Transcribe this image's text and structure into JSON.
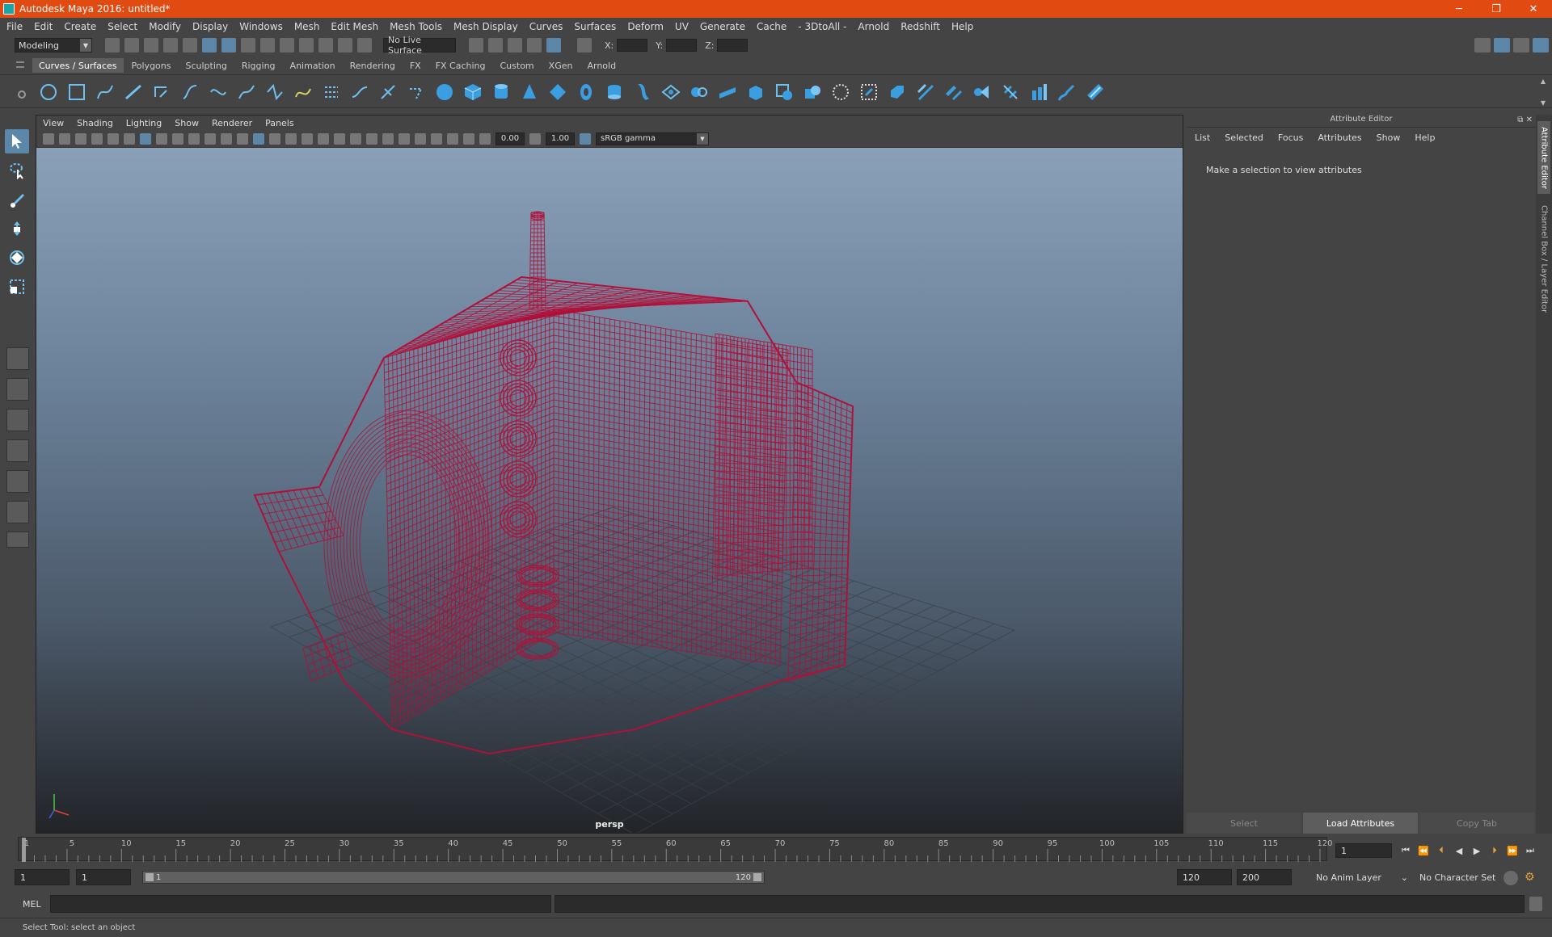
{
  "window": {
    "title": "Autodesk Maya 2016: untitled*",
    "controls": [
      "─",
      "❐",
      "✕"
    ]
  },
  "menubar": [
    "File",
    "Edit",
    "Create",
    "Select",
    "Modify",
    "Display",
    "Windows",
    "Mesh",
    "Edit Mesh",
    "Mesh Tools",
    "Mesh Display",
    "Curves",
    "Surfaces",
    "Deform",
    "UV",
    "Generate",
    "Cache",
    "- 3DtoAll -",
    "Arnold",
    "Redshift",
    "Help"
  ],
  "statusline": {
    "mode": "Modeling",
    "live_surface": "No Live Surface",
    "x_label": "X:",
    "y_label": "Y:",
    "z_label": "Z:"
  },
  "shelf": {
    "tabs": [
      "Curves / Surfaces",
      "Polygons",
      "Sculpting",
      "Rigging",
      "Animation",
      "Rendering",
      "FX",
      "FX Caching",
      "Custom",
      "XGen",
      "Arnold"
    ],
    "active_tab": 0
  },
  "viewport": {
    "menu": [
      "View",
      "Shading",
      "Lighting",
      "Show",
      "Renderer",
      "Panels"
    ],
    "exposure": "0.00",
    "gamma_value": "1.00",
    "color_space": "sRGB gamma",
    "camera": "persp",
    "wire_color": "#b0103a"
  },
  "attribute_editor": {
    "title": "Attribute Editor",
    "menu": [
      "List",
      "Selected",
      "Focus",
      "Attributes",
      "Show",
      "Help"
    ],
    "message": "Make a selection to view attributes",
    "footer": [
      "Select",
      "Load Attributes",
      "Copy Tab"
    ]
  },
  "side_tabs": [
    "Attribute Editor",
    "Channel Box / Layer Editor"
  ],
  "timeline": {
    "ticks": [
      "1",
      "5",
      "10",
      "15",
      "20",
      "25",
      "30",
      "35",
      "40",
      "45",
      "50",
      "55",
      "60",
      "65",
      "70",
      "75",
      "80",
      "85",
      "90",
      "95",
      "100",
      "105",
      "110",
      "115",
      "120"
    ],
    "current_frame": "1"
  },
  "range": {
    "start": "1",
    "playback_start": "1",
    "slider_start": "1",
    "slider_end": "120",
    "playback_end": "120",
    "end": "200",
    "anim_layer": "No Anim Layer",
    "character_set": "No Character Set"
  },
  "cmdline": {
    "label": "MEL"
  },
  "helpline": "Select Tool: select an object"
}
